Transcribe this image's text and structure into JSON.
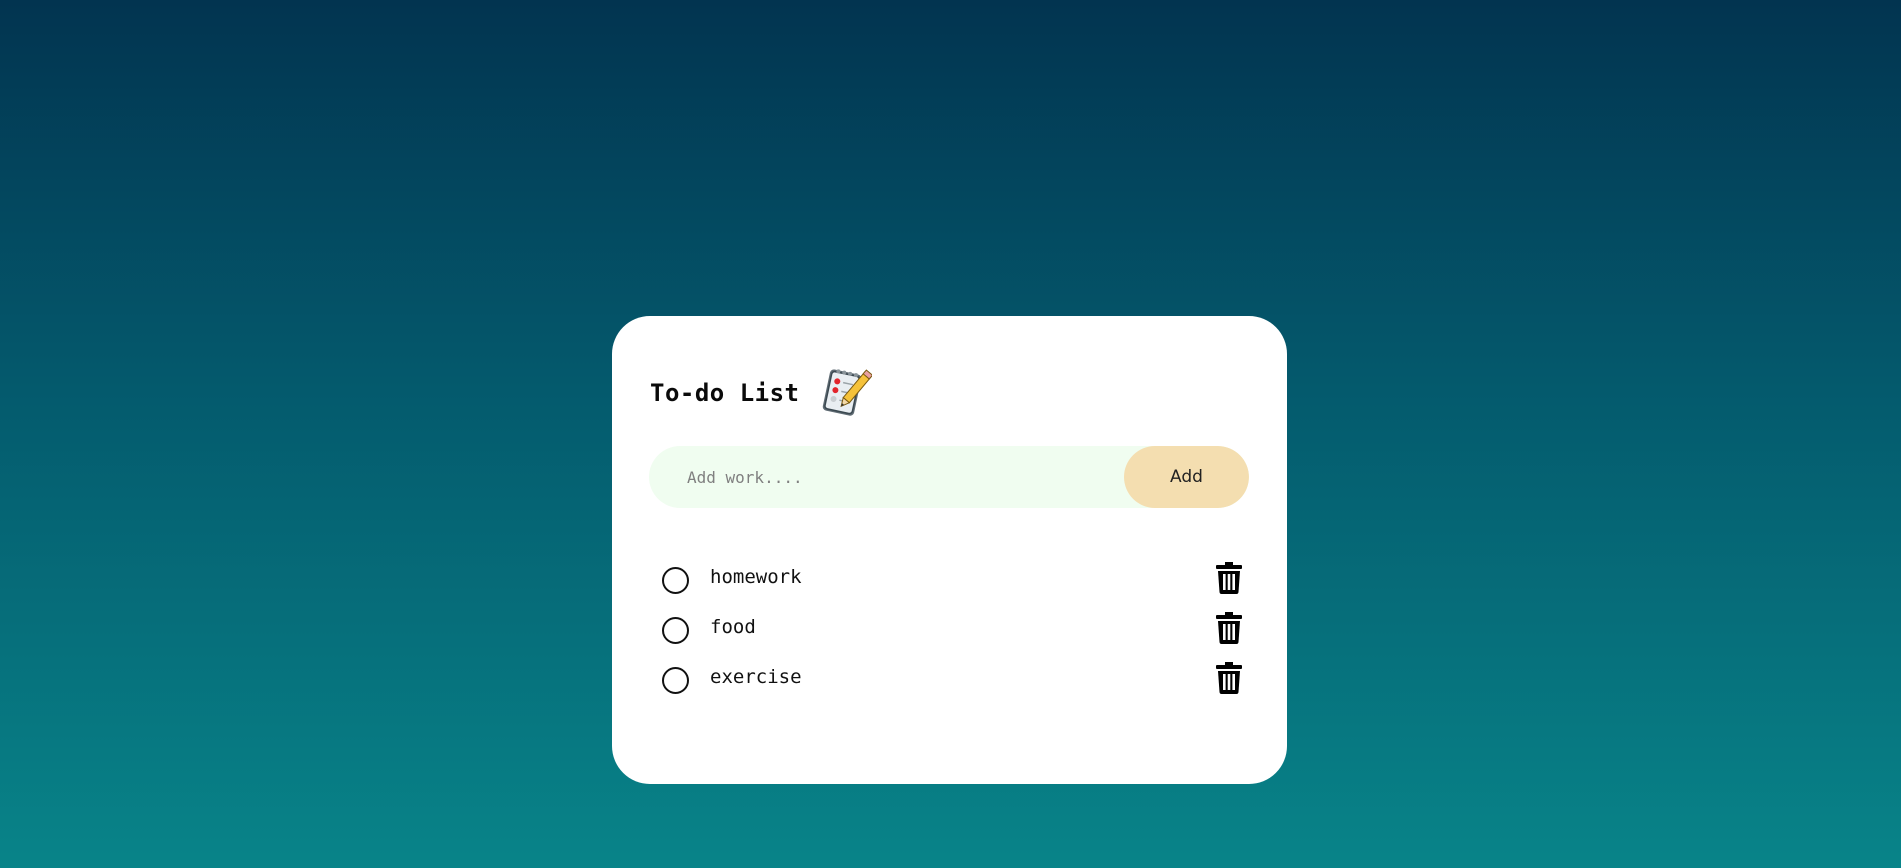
{
  "app": {
    "title": "To-do List",
    "title_icon": "notepad-with-pencil-icon"
  },
  "input": {
    "placeholder": "Add work....",
    "value": ""
  },
  "add_button": {
    "label": "Add"
  },
  "tasks": [
    {
      "label": "homework",
      "done": false,
      "delete_icon": "trash-icon"
    },
    {
      "label": "food",
      "done": false,
      "delete_icon": "trash-icon"
    },
    {
      "label": "exercise",
      "done": false,
      "delete_icon": "trash-icon"
    }
  ],
  "colors": {
    "background_top": "#023450",
    "background_bottom": "#088489",
    "card": "#ffffff",
    "input_bg": "#f0fdf0",
    "button_bg": "#f4deb0"
  }
}
